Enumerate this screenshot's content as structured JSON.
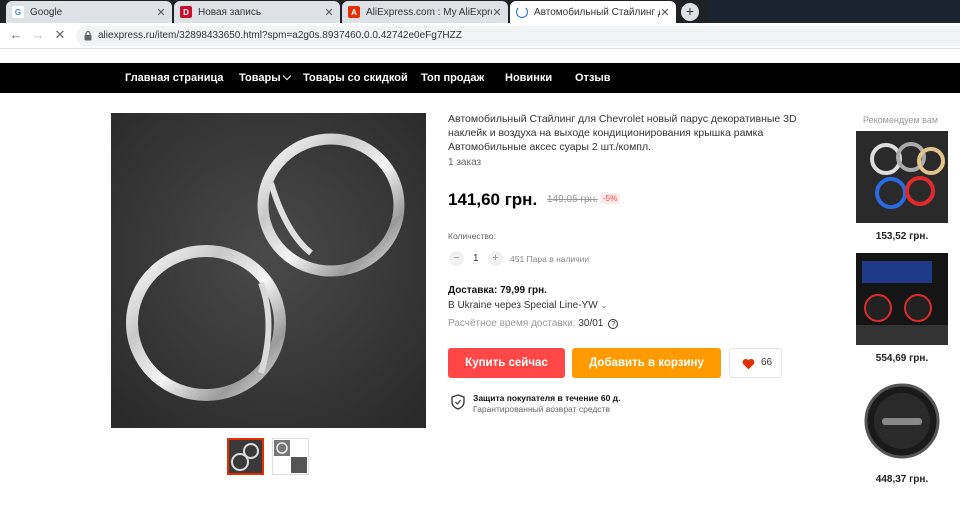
{
  "browser": {
    "tabs": [
      {
        "title": "Google",
        "icon": "google-icon"
      },
      {
        "title": "Новая запись",
        "icon": "drive2-icon"
      },
      {
        "title": "AliExpress.com : My AliExpress",
        "icon": "aliexpress-icon"
      },
      {
        "title": "Автомобильный Стайлинг для Ch",
        "icon": "loading-icon",
        "active": true
      }
    ],
    "url": "aliexpress.ru/item/32898433650.html?spm=a2g0s.8937460.0.0.42742e0eFg7HZZ"
  },
  "nav": {
    "items": [
      "Главная страница",
      "Товары",
      "Товары со скидкой",
      "Топ продаж",
      "Новинки",
      "Отзыв"
    ]
  },
  "product": {
    "title": "Автомобильный Стайлинг для Chevrolet новый парус декоративные 3D наклейк и воздуха на выходе кондиционирования крышка рамка Автомобильные аксес суары 2 шт./компл.",
    "orders": "1 заказ",
    "price": "141,60 грн.",
    "old_price": "149,05 грн.",
    "discount": "-5%",
    "quantity_label": "Количество:",
    "quantity": "1",
    "available": "451 Пара в наличии",
    "shipping": "Доставка: 79,99 грн.",
    "shipping_route": "В Ukraine через Special Line-YW",
    "shipping_time_label": "Расчётное время доставки:",
    "shipping_date": "30/01",
    "buy_label": "Купить сейчас",
    "cart_label": "Добавить в корзину",
    "wishlist_count": "66",
    "protection_title": "Защита покупателя в течение 60 д.",
    "protection_sub": "Гарантированный возврат средств"
  },
  "recommend": {
    "title": "Рекомендуем вам",
    "items": [
      {
        "price": "153,52 грн."
      },
      {
        "price": "554,69 грн."
      },
      {
        "price": "448,37 грн."
      }
    ]
  },
  "colors": {
    "buy": "#ff4747",
    "cart": "#ff9a00",
    "nav_bg": "#000000",
    "accent": "#e62e04"
  }
}
